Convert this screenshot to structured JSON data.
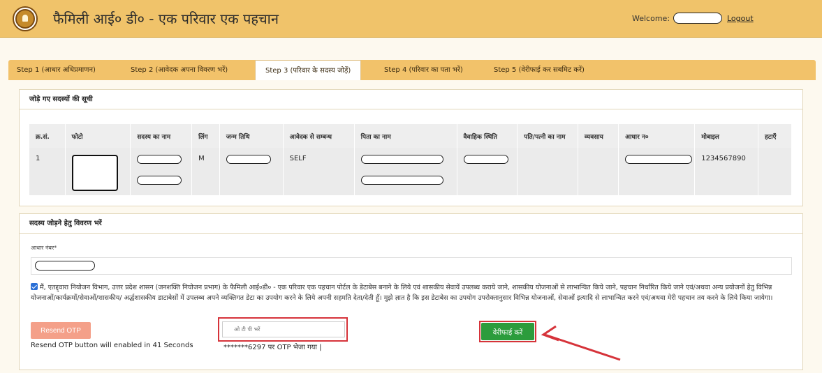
{
  "header": {
    "title": "फैमिली आई० डी० - एक परिवार एक पहचान",
    "welcome_label": "Welcome:",
    "logout_label": "Logout"
  },
  "tabs": [
    {
      "label": "Step 1 (आधार अधिप्रमाणन)"
    },
    {
      "label": "Step 2 (आवेदक अपना विवरण भरें)"
    },
    {
      "label": "Step 3 (परिवार के सदस्य जोड़ें)"
    },
    {
      "label": "Step 4 (परिवार का पता भरें)"
    },
    {
      "label": "Step 5 (वेरीफाई कर सबमिट करें)"
    }
  ],
  "members_section": {
    "title": "जोड़े गए सदस्यों की सूची",
    "columns": [
      "क्र.सं.",
      "फोटो",
      "सदस्य का नाम",
      "लिंग",
      "जन्म तिथि",
      "आवेदक से सम्बन्ध",
      "पिता का नाम",
      "वैवाहिक स्थिति",
      "पति/पत्नी का नाम",
      "व्यवसाय",
      "आधार न०",
      "मोबाइल",
      "हटाएँ"
    ],
    "rows": [
      {
        "sno": "1",
        "gender": "M",
        "relation": "SELF",
        "mobile": "1234567890"
      }
    ]
  },
  "add_section": {
    "title": "सदस्य जोड़ने हेतु विवरण भरें",
    "aadhaar_label": "आधार नंबर*",
    "consent_text": "मैं, एतद्द्वारा नियोजन विभाग, उत्तर प्रदेश शासन (जनशक्ति नियोजन प्रभाग) के फैमिली आई०डी० - एक परिवार एक पहचान पोर्टल के डेटाबेस बनाने के लिये एवं शासकीय सेवायें उपलब्ध कराये जाने, शासकीय योजनाओं से लाभान्वित किये जाने, पहचान निर्धारित किये जाने एवं/अथवा अन्य प्रयोजनों हेतु विभिन्न योजनाओं/कार्यक्रमों/सेवाओं/शासकीय/ अर्द्धशासकीय डाटाबेसों में उपलब्ध अपने व्यक्तिगत डेटा का उपयोग करने के लिये अपनी सहमति देता/देती हूँ। मुझे ज्ञात है कि इस डेटाबेस का उपयोग उपरोक्तानुसार विभिन्न योजनाओं, सेवाओं इत्यादि से लाभान्वित करने एवं/अथवा मेरी पहचान तय करने के लिये किया जायेगा।",
    "consent_checked": true,
    "resend_label": "Resend OTP",
    "resend_note": "Resend OTP button will enabled in 41 Seconds",
    "otp_placeholder": "ओ टी पी भरें",
    "otp_sent_text": "*******6297 पर OTP भेजा गया |",
    "verify_label": "वेरीफाई करें"
  },
  "colors": {
    "header_bg": "#f0c36a",
    "verify_button": "#2c9c3c",
    "resend_button": "#f4a089",
    "highlight": "#d6333a"
  }
}
